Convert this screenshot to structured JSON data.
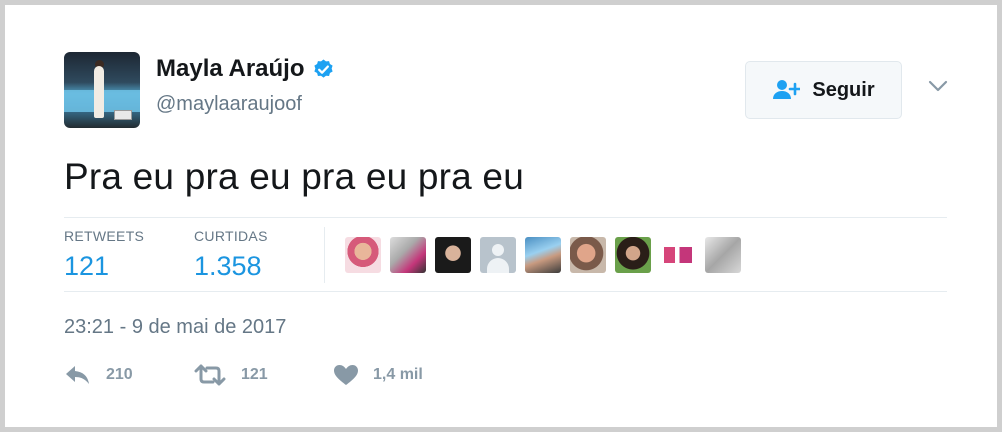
{
  "author": {
    "name": "Mayla Araújo",
    "handle": "@maylaaraujoof",
    "verified": true
  },
  "follow_button": {
    "label": "Seguir"
  },
  "tweet": {
    "text": "Pra eu pra eu pra eu pra eu"
  },
  "stats": {
    "retweets_label": "RETWEETS",
    "retweets_value": "121",
    "likes_label": "CURTIDAS",
    "likes_value": "1.358"
  },
  "timestamp": "23:21 - 9 de mai de 2017",
  "actions": {
    "reply_count": "210",
    "retweet_count": "121",
    "like_count": "1,4 mil"
  },
  "colors": {
    "accent": "#1b95e0",
    "muted": "#657786",
    "action_gray": "#8899a6",
    "verified_badge": "#1da1f2"
  },
  "icons": [
    "verified-icon",
    "follow-user-icon",
    "chevron-down-icon",
    "reply-icon",
    "retweet-icon",
    "heart-icon"
  ]
}
